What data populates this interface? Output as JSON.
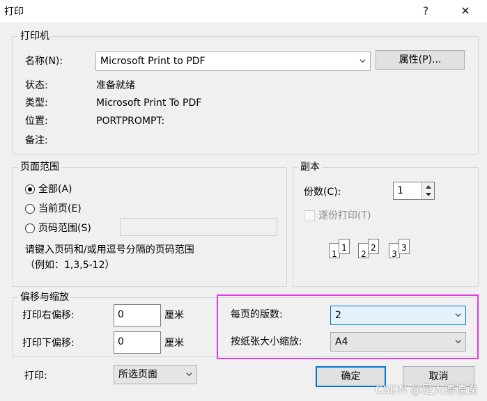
{
  "window": {
    "title": "打印",
    "help_label": "?",
    "close_label": "✕"
  },
  "printer": {
    "group_label": "打印机",
    "name_label": "名称(N):",
    "name_value": "Microsoft Print to PDF",
    "properties_button": "属性(P)...",
    "status_label": "状态:",
    "status_value": "准备就绪",
    "type_label": "类型:",
    "type_value": "Microsoft Print To PDF",
    "location_label": "位置:",
    "location_value": "PORTPROMPT:",
    "comment_label": "备注:",
    "comment_value": ""
  },
  "page_range": {
    "group_label": "页面范围",
    "options": [
      {
        "label": "全部(A)",
        "selected": true
      },
      {
        "label": "当前页(E)",
        "selected": false
      },
      {
        "label": "页码范围(S)",
        "selected": false
      }
    ],
    "range_value": "",
    "hint_line1": "请键入页码和/或用逗号分隔的页码范围",
    "hint_line2": "（例如：1,3,5-12）"
  },
  "copies": {
    "group_label": "副本",
    "count_label": "份数(C):",
    "count_value": "1",
    "collate_label": "逐份打印(T)",
    "collate_checked": false,
    "collate_glyphs": [
      "1",
      "1",
      "2",
      "2",
      "3",
      "3"
    ]
  },
  "offset": {
    "group_label": "偏移与缩放",
    "right_label": "打印右偏移:",
    "right_value": "0",
    "right_unit": "厘米",
    "down_label": "打印下偏移:",
    "down_value": "0",
    "down_unit": "厘米",
    "pages_per_sheet_label": "每页的版数:",
    "pages_per_sheet_value": "2",
    "scale_label": "按纸张大小缩放:",
    "scale_value": "A4"
  },
  "footer": {
    "print_label": "打印:",
    "print_value": "所选页面",
    "ok_button": "确定",
    "cancel_button": "取消",
    "watermark": "CSDN @是大德德诶"
  },
  "colors": {
    "highlight": "#e23ae0",
    "focus": "#0078d7"
  }
}
